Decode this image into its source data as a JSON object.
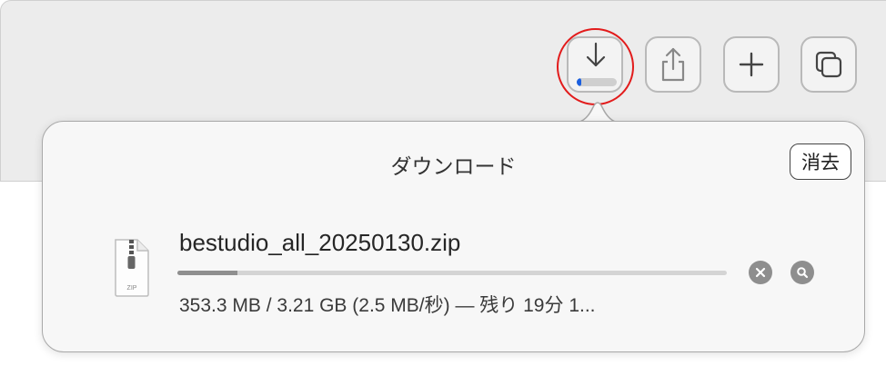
{
  "toolbar": {
    "buttons": [
      {
        "name": "download-icon",
        "progress": 0.12
      },
      {
        "name": "share-icon"
      },
      {
        "name": "plus-icon"
      },
      {
        "name": "tabs-icon"
      }
    ],
    "accent_color": "#1a5fe0",
    "highlight_color": "#e21b1b"
  },
  "downloads": {
    "title": "ダウンロード",
    "clear_label": "消去",
    "items": [
      {
        "file_name": "bestudio_all_20250130.zip",
        "file_type_label": "ZIP",
        "progress": 0.11,
        "status": "353.3 MB / 3.21 GB (2.5 MB/秒) — 残り 19分 1...",
        "icons": [
          "zip-file-icon",
          "cancel-icon",
          "magnifier-icon"
        ]
      }
    ]
  }
}
